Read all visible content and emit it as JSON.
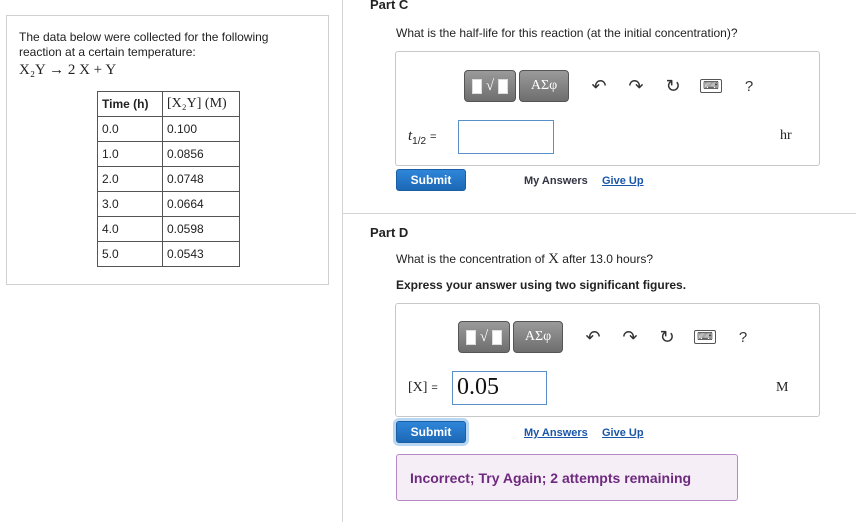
{
  "problem": {
    "intro": "The data below were collected for the following reaction at a certain temperature:",
    "reaction": "X₂Y → 2 X + Y",
    "table": {
      "headers": [
        "Time (h)",
        "[X₂Y] (M)"
      ],
      "rows": [
        [
          "0.0",
          "0.100"
        ],
        [
          "1.0",
          "0.0856"
        ],
        [
          "2.0",
          "0.0748"
        ],
        [
          "3.0",
          "0.0664"
        ],
        [
          "4.0",
          "0.0598"
        ],
        [
          "5.0",
          "0.0543"
        ]
      ]
    }
  },
  "toolbar": {
    "template_symbol": "√",
    "greek_label": "ΑΣφ",
    "undo_icon": "↶",
    "redo_icon": "↷",
    "reset_icon": "↻",
    "keyboard_icon": "⌨",
    "help_label": "?"
  },
  "part_c": {
    "title": "Part C",
    "question": "What is the half-life for this reaction (at the initial concentration)?",
    "variable_label": "t",
    "variable_sub": "1/2",
    "equals": "=",
    "input_value": "",
    "unit": "hr",
    "submit_label": "Submit",
    "my_answers_label": "My Answers",
    "give_up_label": "Give Up"
  },
  "part_d": {
    "title": "Part D",
    "question_pre": "What is the concentration of ",
    "question_symbol": "X",
    "question_post": " after 13.0 hours?",
    "instruction": "Express your answer using two significant figures.",
    "variable_label": "[X]",
    "equals": "=",
    "input_value": "0.05",
    "unit": "M",
    "submit_label": "Submit",
    "my_answers_label": "My Answers",
    "give_up_label": "Give Up",
    "feedback": "Incorrect; Try Again; 2 attempts remaining"
  }
}
